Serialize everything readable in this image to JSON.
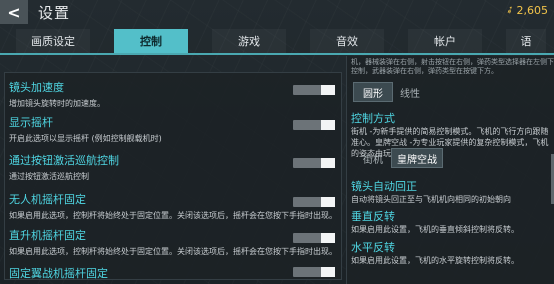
{
  "header": {
    "back_label": "<",
    "title": "设置",
    "coin_value": "2,605",
    "coin_icon": "feather-icon"
  },
  "tabs": [
    {
      "label": "画质设定",
      "active": false
    },
    {
      "label": "控制",
      "active": true
    },
    {
      "label": "游戏",
      "active": false
    },
    {
      "label": "音效",
      "active": false
    },
    {
      "label": "帐户",
      "active": false
    },
    {
      "label": "语",
      "active": false
    }
  ],
  "left_settings": [
    {
      "label": "镜头加速度",
      "desc": "增加镜头旋转时的加速度。",
      "toggle": "on"
    },
    {
      "label": "显示摇杆",
      "desc": "开启此选项以显示摇杆 (例如控制舰载机时)",
      "toggle": "on"
    },
    {
      "label": "通过按钮激活巡航控制",
      "desc": "通过按钮激活巡航控制",
      "toggle": "on"
    },
    {
      "label": "无人机摇杆固定",
      "desc": "如果启用此选项，控制杆将始终处于固定位置。关闭该选项后，摇杆会在您按下手指时出现。",
      "toggle": "on"
    },
    {
      "label": "直升机摇杆固定",
      "desc": "如果启用此选项，控制杆将始终处于固定位置。关闭该选项后，摇杆会在您按下手指时出现。",
      "toggle": "on"
    },
    {
      "label": "固定翼战机摇杆固定",
      "desc": "",
      "toggle": "on"
    }
  ],
  "right_panel": {
    "top_text_1": "机，器械装弹在右侧，射击按钮在右侧，弹药类型选择器在左侧下方。",
    "top_text_2": "控制，武器装弹在右侧，弹药类型在按键下方。",
    "layout_options": [
      "圆形",
      "线性"
    ],
    "layout_selected": 0,
    "control_mode_label": "控制方式",
    "control_mode_desc": "街机 -为新手提供的简易控制模式。飞机的飞行方向跟随准心。皇牌空战 -为专业玩家提供的复杂控制模式，飞机的姿态由玩家完全控制。",
    "control_mode_options": [
      "街机",
      "皇牌空战"
    ],
    "control_mode_selected": 1,
    "auto_return_label": "镜头自动回正",
    "auto_return_desc": "自动将镜头回正至与飞机机向相同的初始朝向",
    "vertical_invert_label": "垂直反转",
    "vertical_invert_desc": "如果启用此设置，飞机的垂直倾斜控制将反转。",
    "horizontal_invert_label": "水平反转",
    "horizontal_invert_desc": "如果启用此设置，飞机的水平旋转控制将反转。"
  }
}
